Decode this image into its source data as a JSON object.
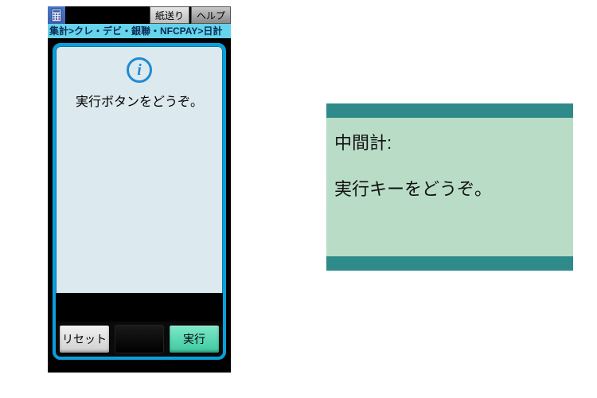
{
  "device": {
    "titlebar": {
      "paper_feed_label": "紙送り",
      "help_label": "ヘルプ"
    },
    "breadcrumb": "集計>クレ・デビ・銀聯・NFCPAY>日計",
    "screen": {
      "info_glyph": "i",
      "message": "実行ボタンをどうぞ。"
    },
    "buttons": {
      "reset_label": "リセット",
      "exec_label": "実行"
    }
  },
  "panel": {
    "title": "中間計:",
    "message": "実行キーをどうぞ。"
  }
}
